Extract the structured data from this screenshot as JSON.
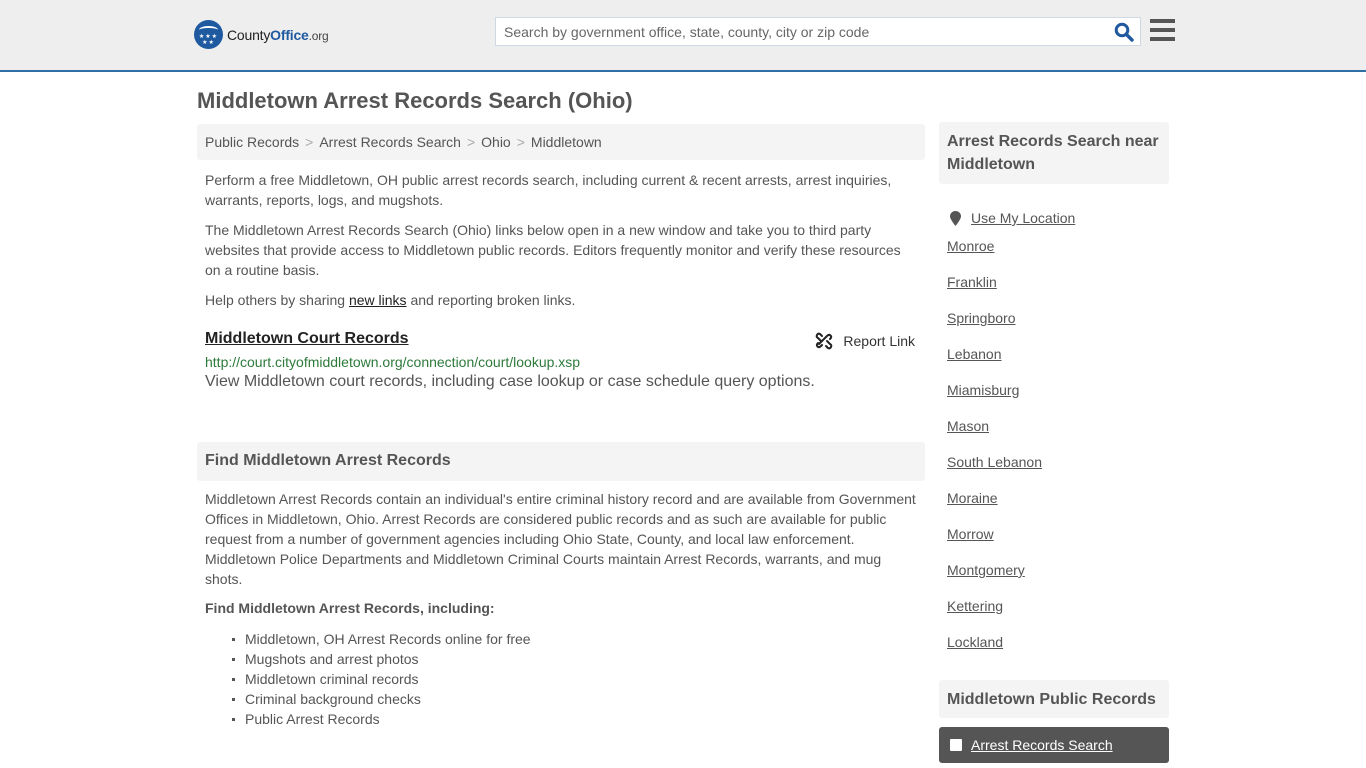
{
  "header": {
    "logo": {
      "county": "County",
      "office": "Office",
      "org": ".org"
    },
    "search": {
      "placeholder": "Search by government office, state, county, city or zip code",
      "value": ""
    },
    "icons": {
      "search": "search-icon",
      "menu": "hamburger-menu-icon"
    },
    "accent_color": "#2f6fa6"
  },
  "page": {
    "title": "Middletown Arrest Records Search (Ohio)"
  },
  "breadcrumb": [
    {
      "label": "Public Records"
    },
    {
      "label": "Arrest Records Search"
    },
    {
      "label": "Ohio"
    },
    {
      "label": "Middletown"
    }
  ],
  "intro": {
    "p1": "Perform a free Middletown, OH public arrest records search, including current & recent arrests, arrest inquiries, warrants, reports, logs, and mugshots.",
    "p2": "The Middletown Arrest Records Search (Ohio) links below open in a new window and take you to third party websites that provide access to Middletown public records. Editors frequently monitor and verify these resources on a routine basis.",
    "p3_before": "Help others by sharing ",
    "p3_link": "new links",
    "p3_after": " and reporting broken links."
  },
  "links": [
    {
      "title": "Middletown Court Records",
      "url": "http://court.cityofmiddletown.org/connection/court/lookup.xsp",
      "description": "View Middletown court records, including case lookup or case schedule query options.",
      "report_label": "Report Link"
    }
  ],
  "find_section": {
    "heading": "Find Middletown Arrest Records",
    "body": "Middletown Arrest Records contain an individual's entire criminal history record and are available from Government Offices in Middletown, Ohio. Arrest Records are considered public records and as such are available for public request from a number of government agencies including Ohio State, County, and local law enforcement. Middletown Police Departments and Middletown Criminal Courts maintain Arrest Records, warrants, and mug shots.",
    "subheading": "Find Middletown Arrest Records, including:",
    "bullets": [
      "Middletown, OH Arrest Records online for free",
      "Mugshots and arrest photos",
      "Middletown criminal records",
      "Criminal background checks",
      "Public Arrest Records"
    ]
  },
  "sidebar": {
    "near_heading": "Arrest Records Search near Middletown",
    "use_location": "Use My Location",
    "nearby": [
      "Monroe",
      "Franklin",
      "Springboro",
      "Lebanon",
      "Miamisburg",
      "Mason",
      "South Lebanon",
      "Moraine",
      "Morrow",
      "Montgomery",
      "Kettering",
      "Lockland"
    ],
    "public_records_heading": "Middletown Public Records",
    "public_records_items": [
      {
        "label": "Arrest Records Search",
        "active": true
      }
    ]
  }
}
